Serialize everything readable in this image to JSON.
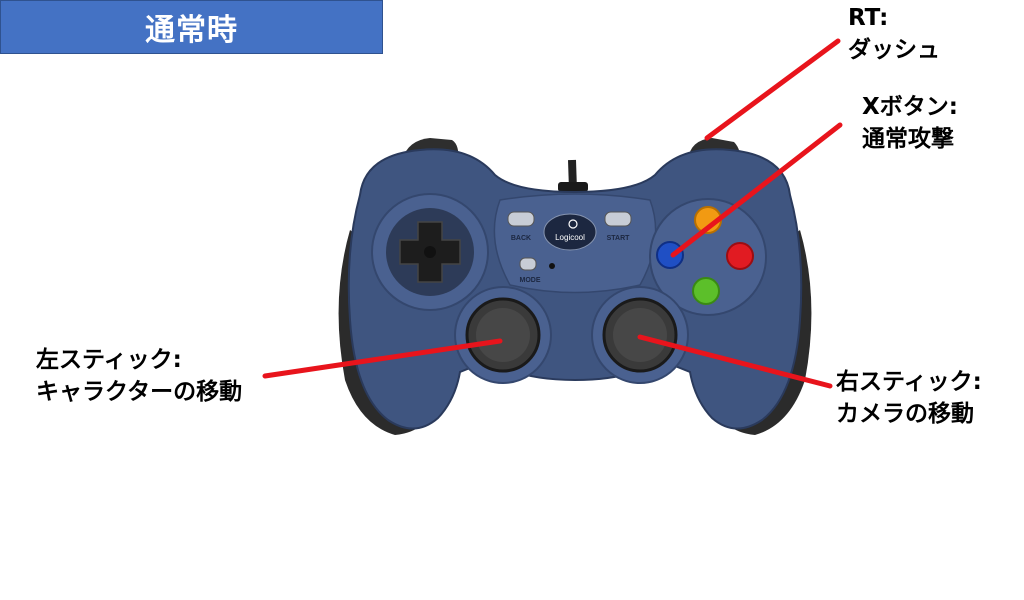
{
  "title": "通常時",
  "controller": {
    "logo_text": "Logicool",
    "back_text": "BACK",
    "start_text": "START",
    "mode_text": "MODE"
  },
  "labels": {
    "rt": {
      "line1": "RT:",
      "line2": "ダッシュ"
    },
    "x_button": {
      "line1": "Xボタン:",
      "line2": "通常攻撃"
    },
    "left_stick": {
      "line1": "左スティック:",
      "line2": "キャラクターの移動"
    },
    "right_stick": {
      "line1": "右スティック:",
      "line2": "カメラの移動"
    }
  },
  "colors": {
    "title_bg": "#4472c4",
    "pointer": "#e8141c",
    "body": "#3f5580",
    "grips": "#2b2b2b",
    "button_a": "#5cbf2a",
    "button_b": "#e11b22",
    "button_x": "#1f4fc4",
    "button_y": "#f29a12"
  }
}
